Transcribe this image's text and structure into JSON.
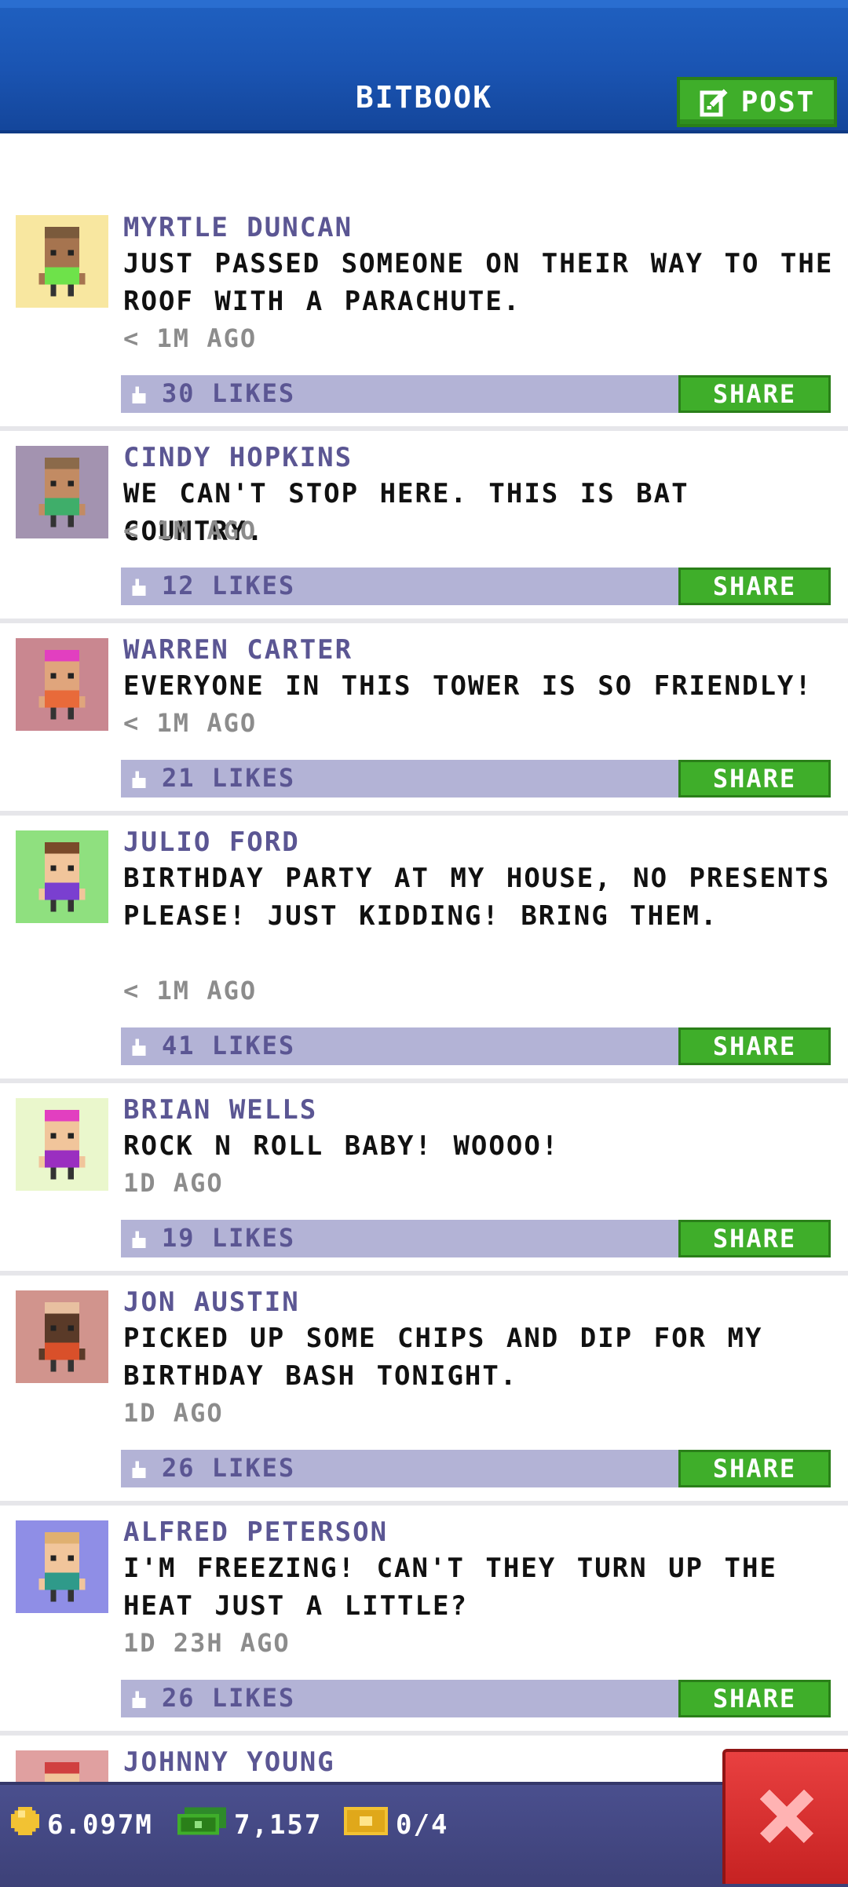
{
  "header": {
    "title": "BITBOOK",
    "post_label": "POST"
  },
  "posts": [
    {
      "name": "MYRTLE DUNCAN",
      "message": "JUST PASSED SOMEONE ON THEIR WAY TO THE ROOF WITH A PARACHUTE.",
      "time": "< 1M AGO",
      "likes": "30 LIKES",
      "share": "SHARE",
      "avatar_bg": "#f8e7a0",
      "skin": "#a6744f",
      "shirt": "#6ee24a",
      "hair": "#7a5a3c"
    },
    {
      "name": "CINDY HOPKINS",
      "message": "WE CAN'T STOP HERE. THIS IS BAT COUNTRY.",
      "time": "< 1M AGO",
      "likes": "12 LIKES",
      "share": "SHARE",
      "avatar_bg": "#a393b0",
      "skin": "#c28b63",
      "shirt": "#3fae6a",
      "hair": "#8b6a4a"
    },
    {
      "name": "WARREN CARTER",
      "message": "EVERYONE IN THIS TOWER IS SO FRIENDLY!",
      "time": "< 1M AGO",
      "likes": "21 LIKES",
      "share": "SHARE",
      "avatar_bg": "#c98790",
      "skin": "#e0a57c",
      "shirt": "#e86a3a",
      "hair": "#e23fc0"
    },
    {
      "name": "JULIO FORD",
      "message": "BIRTHDAY PARTY AT MY HOUSE, NO PRESENTS PLEASE! JUST KIDDING! BRING THEM.",
      "time": "< 1M AGO",
      "likes": "41 LIKES",
      "share": "SHARE",
      "avatar_bg": "#8fe07f",
      "skin": "#f1c59b",
      "shirt": "#7a3fd0",
      "hair": "#7a4a2a"
    },
    {
      "name": "BRIAN WELLS",
      "message": "ROCK N ROLL BABY! WOOOO!",
      "time": "1D AGO",
      "likes": "19 LIKES",
      "share": "SHARE",
      "avatar_bg": "#eaf7cc",
      "skin": "#f1c59b",
      "shirt": "#9a2fc0",
      "hair": "#e23fc0"
    },
    {
      "name": "JON AUSTIN",
      "message": "PICKED UP SOME CHIPS AND DIP FOR MY BIRTHDAY BASH TONIGHT.",
      "time": "1D AGO",
      "likes": "26 LIKES",
      "share": "SHARE",
      "avatar_bg": "#d1948d",
      "skin": "#5a3a28",
      "shirt": "#d9502a",
      "hair": "#e8c0a0"
    },
    {
      "name": "ALFRED PETERSON",
      "message": "I'M FREEZING! CAN'T THEY TURN UP THE HEAT JUST A LITTLE?",
      "time": "1D 23H AGO",
      "likes": "26 LIKES",
      "share": "SHARE",
      "avatar_bg": "#8f8ee6",
      "skin": "#f1c59b",
      "shirt": "#2f9a8a",
      "hair": "#e0b070"
    },
    {
      "name": "JOHNNY YOUNG",
      "avatar_bg": "#e0a0a0",
      "skin": "#f1c59b",
      "shirt": "#d04040",
      "hair": "#d04040"
    }
  ],
  "bottom_bar": {
    "coins": "6.097M",
    "bux": "7,157",
    "tickets": "0/4"
  },
  "colors": {
    "header": "#1a54b2",
    "green": "#3fae2a",
    "likes_bar": "#b3b3d6",
    "name": "#5b5693",
    "close": "#d42a2a"
  }
}
